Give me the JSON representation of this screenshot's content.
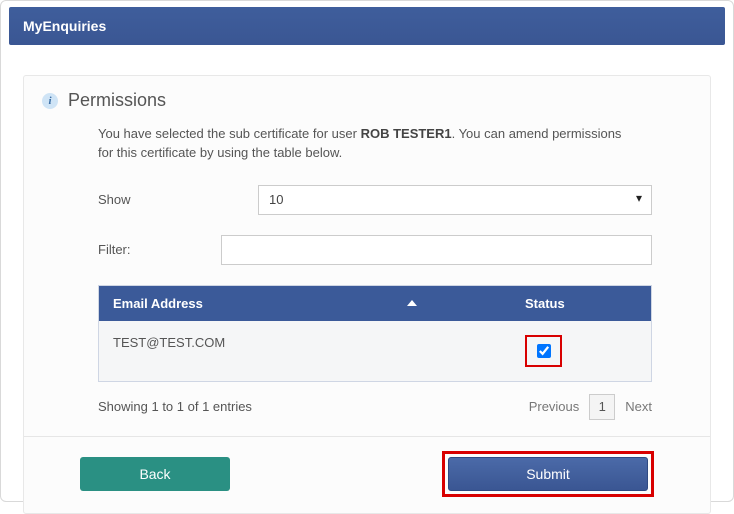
{
  "title": "MyEnquiries",
  "section": {
    "title": "Permissions",
    "intro_prefix": "You have selected the sub certificate for user ",
    "intro_user": "ROB TESTER1",
    "intro_suffix": ". You can amend permissions for this certificate by using the table below."
  },
  "controls": {
    "show_label": "Show",
    "show_value": "10",
    "filter_label": "Filter:",
    "filter_value": ""
  },
  "table": {
    "col_email": "Email Address",
    "col_status": "Status",
    "rows": [
      {
        "email": "TEST@TEST.COM",
        "checked": true
      }
    ]
  },
  "pager": {
    "info": "Showing 1 to 1 of 1 entries",
    "prev": "Previous",
    "page": "1",
    "next": "Next"
  },
  "buttons": {
    "back": "Back",
    "submit": "Submit"
  }
}
